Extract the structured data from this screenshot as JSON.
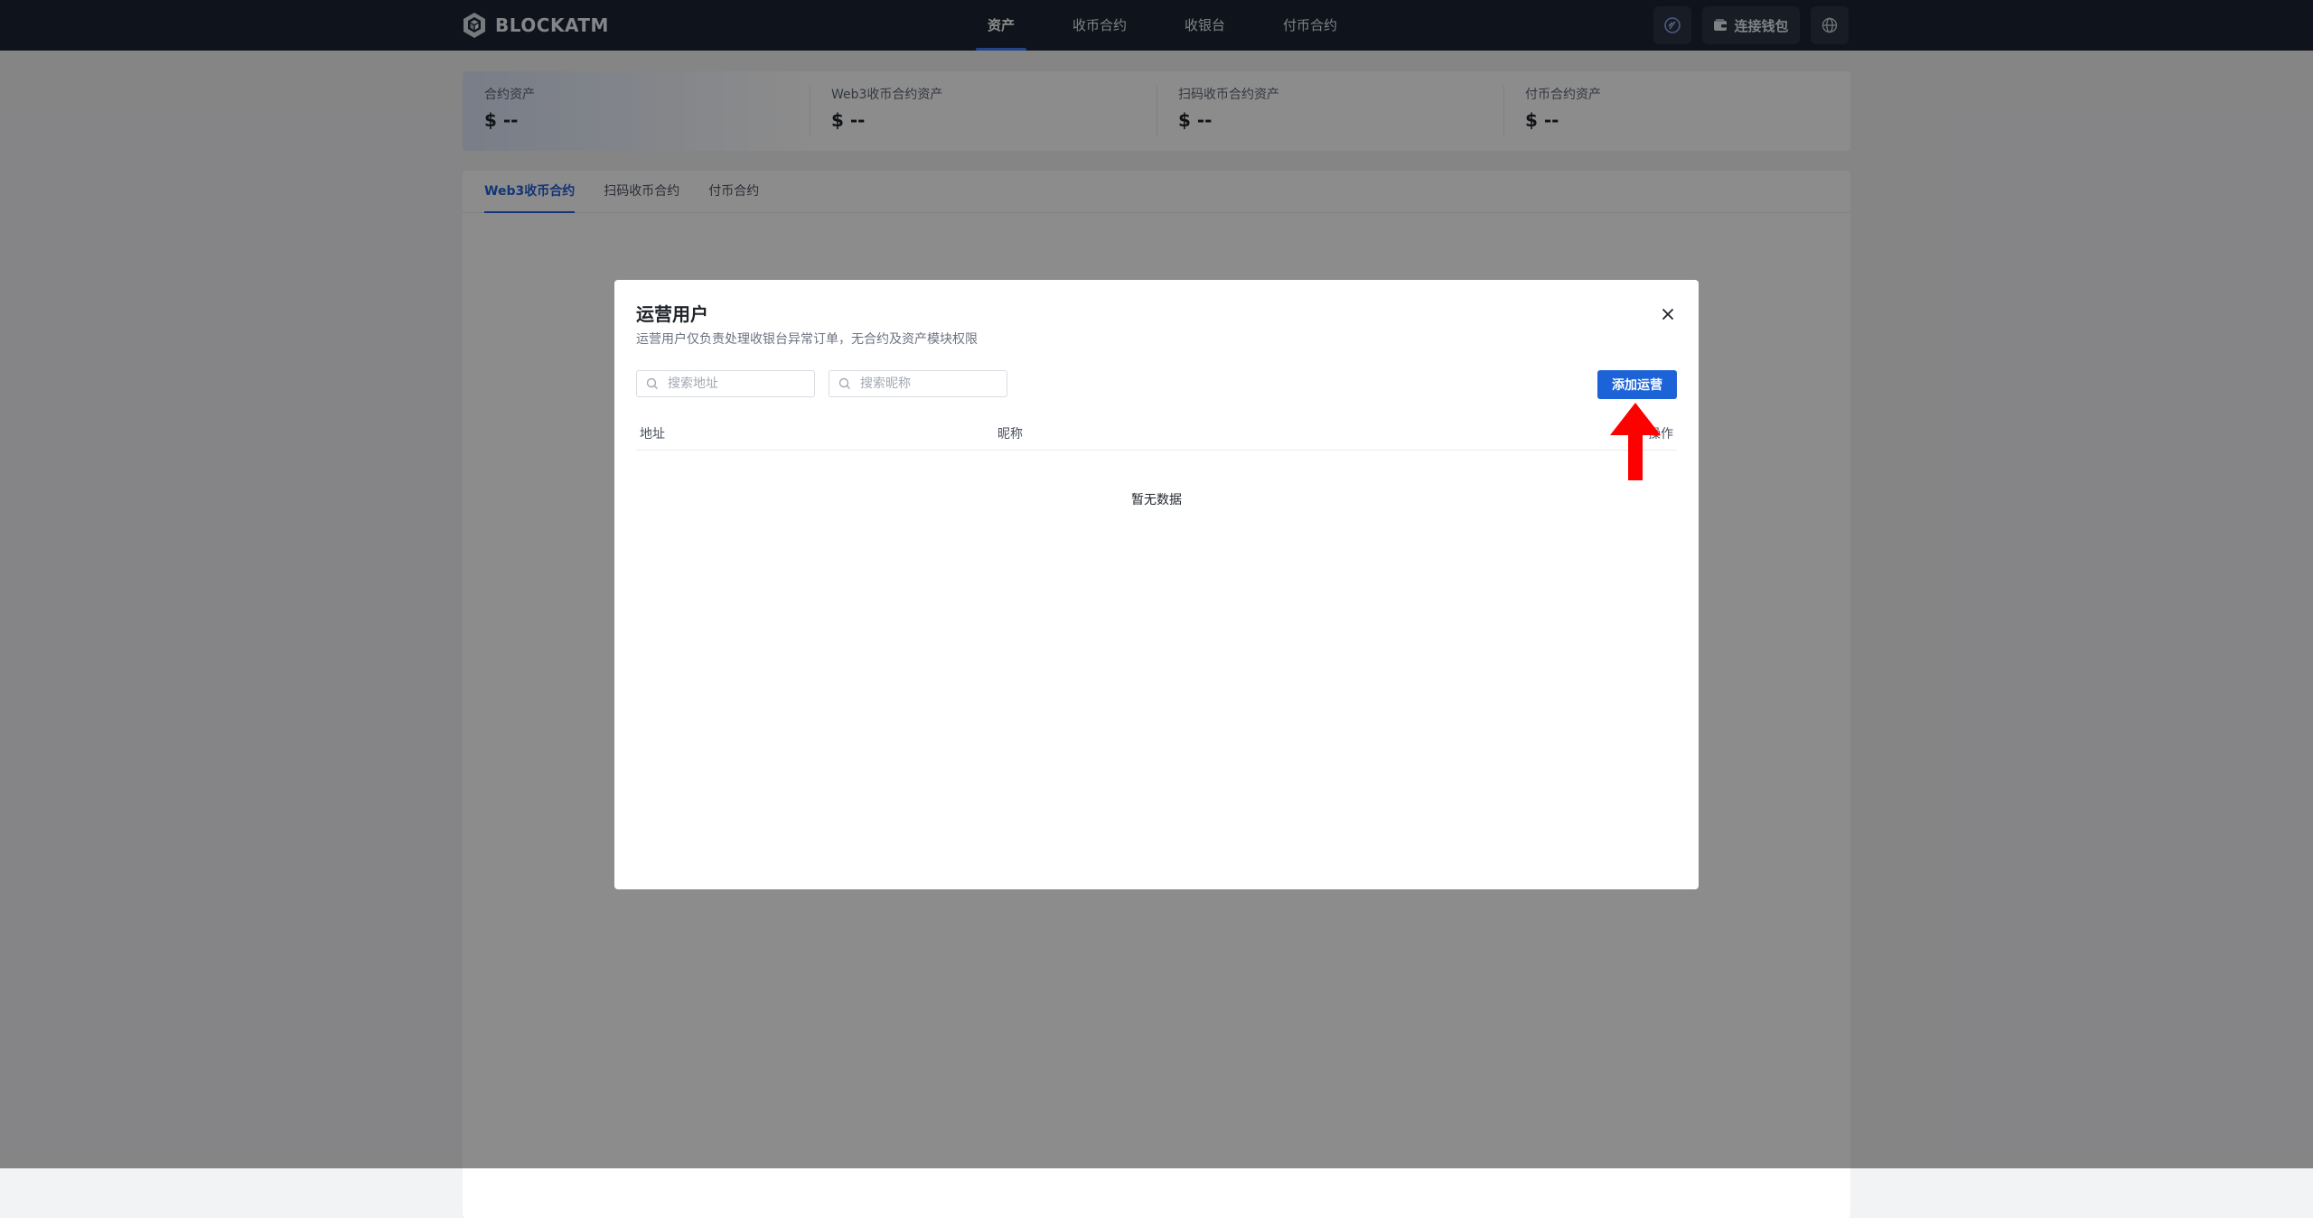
{
  "brand": {
    "name": "BLOCKATM",
    "logo_icon": "hexagon-cube-logo"
  },
  "nav": {
    "items": [
      {
        "label": "资产",
        "active": true
      },
      {
        "label": "收币合约",
        "active": false
      },
      {
        "label": "收银台",
        "active": false
      },
      {
        "label": "付币合约",
        "active": false
      }
    ]
  },
  "toolbar": {
    "chain_icon": "ethereum-chain-icon",
    "wallet_icon": "wallet-icon",
    "wallet_label": "连接钱包",
    "language_icon": "globe-icon"
  },
  "stats": [
    {
      "label": "合约资产",
      "value": "$ --"
    },
    {
      "label": "Web3收币合约资产",
      "value": "$ --"
    },
    {
      "label": "扫码收币合约资产",
      "value": "$ --"
    },
    {
      "label": "付币合约资产",
      "value": "$ --"
    }
  ],
  "tabs": [
    {
      "label": "Web3收币合约",
      "active": true
    },
    {
      "label": "扫码收币合约",
      "active": false
    },
    {
      "label": "付币合约",
      "active": false
    }
  ],
  "modal": {
    "title": "运营用户",
    "subtitle": "运营用户仅负责处理收银台异常订单，无合约及资产模块权限",
    "search_address_placeholder": "搜索地址",
    "search_nickname_placeholder": "搜索昵称",
    "add_button_label": "添加运营",
    "columns": {
      "address": "地址",
      "nickname": "昵称",
      "action": "操作"
    },
    "empty_text": "暂无数据"
  },
  "colors": {
    "topbar_bg": "#1c2333",
    "accent": "#1d63d8",
    "annotation_arrow": "#ff0000"
  }
}
